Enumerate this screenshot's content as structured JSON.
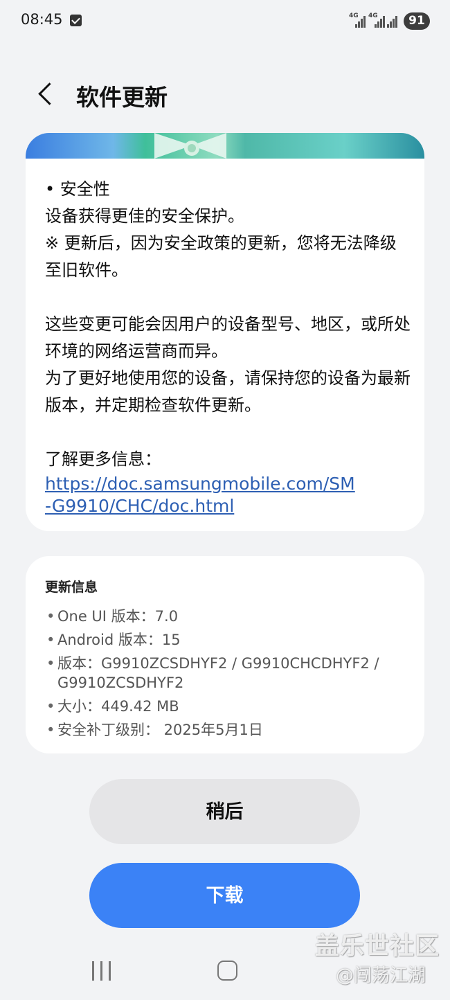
{
  "status_bar": {
    "time": "08:45",
    "signal1_label": "4G",
    "signal2_label": "4G",
    "battery": "91"
  },
  "header": {
    "title": "软件更新"
  },
  "notes": {
    "lines": [
      "• 安全性",
      "设备获得更佳的安全保护。",
      "※ 更新后，因为安全政策的更新，您将无法降级至旧软件。"
    ],
    "lines2": [
      "这些变更可能会因用户的设备型号、地区，或所处环境的网络运营商而异。",
      "为了更好地使用您的设备，请保持您的设备为最新版本，并定期检查软件更新。"
    ],
    "more_info_label": "了解更多信息：",
    "link": "https://doc.samsungmobile.com/SM-G9910/CHC/doc.html"
  },
  "update_info": {
    "heading": "更新信息",
    "items": [
      "One UI 版本：7.0",
      "Android 版本：15",
      "版本：G9910ZCSDHYF2 / G9910CHCDHYF2 / G9910ZCSDHYF2",
      "大小：449.42 MB",
      "安全补丁级别： 2025年5月1日"
    ]
  },
  "buttons": {
    "later": "稍后",
    "download": "下载"
  },
  "watermark": {
    "main": "盖乐世社区",
    "sub": "@闯荡江湖"
  },
  "colors": {
    "accent": "#3b82f6",
    "background": "#f2f3f5",
    "link": "#2d5fb3"
  }
}
